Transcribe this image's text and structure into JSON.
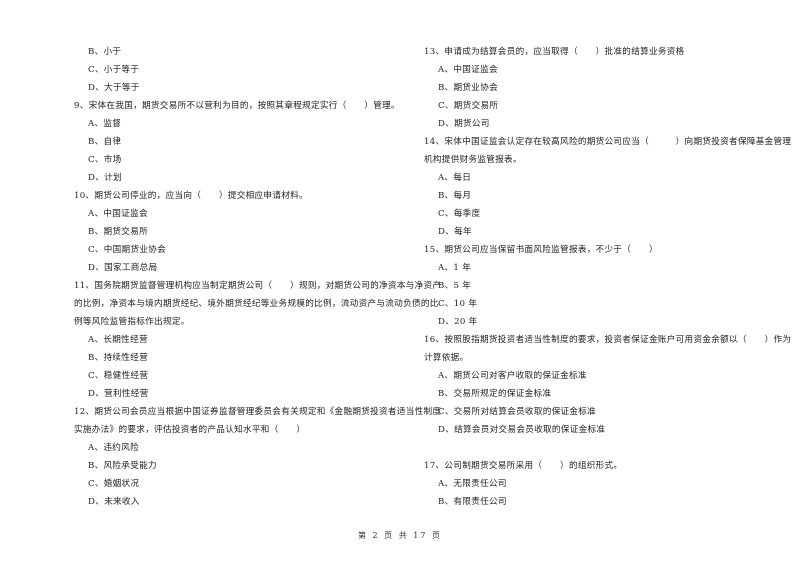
{
  "left_column": [
    {
      "type": "opt",
      "text": "B、小于"
    },
    {
      "type": "opt",
      "text": "C、小于等于"
    },
    {
      "type": "opt",
      "text": "D、大于等于"
    },
    {
      "type": "q",
      "text": "9、宋体在我国，期货交易所不以营利为目的，按照其章程规定实行（　　）管理。"
    },
    {
      "type": "opt",
      "text": "A、监督"
    },
    {
      "type": "opt",
      "text": "B、自律"
    },
    {
      "type": "opt",
      "text": "C、市场"
    },
    {
      "type": "opt",
      "text": "D、计划"
    },
    {
      "type": "q",
      "text": "10、期货公司停业的，应当向（　　）提交相应申请材料。"
    },
    {
      "type": "opt",
      "text": "A、中国证监会"
    },
    {
      "type": "opt",
      "text": "B、期货交易所"
    },
    {
      "type": "opt",
      "text": "C、中国期货业协会"
    },
    {
      "type": "opt",
      "text": "D、国家工商总局"
    },
    {
      "type": "q",
      "text": "11、国务院期货监督管理机构应当制定期货公司（　　）规则，对期货公司的净资本与净资产"
    },
    {
      "type": "q",
      "text": "的比例，净资本与境内期货经纪、境外期货经纪等业务规模的比例，流动资产与流动负债的比"
    },
    {
      "type": "q",
      "text": "例等风险监管指标作出规定。"
    },
    {
      "type": "opt",
      "text": "A、长期性经营"
    },
    {
      "type": "opt",
      "text": "B、持续性经营"
    },
    {
      "type": "opt",
      "text": "C、稳健性经营"
    },
    {
      "type": "opt",
      "text": "D、营利性经营"
    },
    {
      "type": "q",
      "text": "12、期货公司会员应当根据中国证券监督管理委员会有关规定和《金融期货投资者适当性制度"
    },
    {
      "type": "q",
      "text": "实施办法》的要求，评估投资者的产品认知水平和（　　）"
    },
    {
      "type": "opt",
      "text": "A、违约风险"
    },
    {
      "type": "opt",
      "text": "B、风险承受能力"
    },
    {
      "type": "opt",
      "text": "C、婚姻状况"
    },
    {
      "type": "opt",
      "text": "D、未来收入"
    }
  ],
  "right_column": [
    {
      "type": "q",
      "text": "13、申请成为结算会员的，应当取得（　　）批准的结算业务资格"
    },
    {
      "type": "opt",
      "text": "A、中国证监会"
    },
    {
      "type": "opt",
      "text": "B、期货业协会"
    },
    {
      "type": "opt",
      "text": "C、期货交易所"
    },
    {
      "type": "opt",
      "text": "D、期货公司"
    },
    {
      "type": "q",
      "text": "14、宋体中国证监会认定存在较高风险的期货公司应当（　　　）向期货投资者保障基金管理"
    },
    {
      "type": "q",
      "text": "机构提供财务监管报表。"
    },
    {
      "type": "opt",
      "text": "A、每日"
    },
    {
      "type": "opt",
      "text": "B、每月"
    },
    {
      "type": "opt",
      "text": "C、每季度"
    },
    {
      "type": "opt",
      "text": "D、每年"
    },
    {
      "type": "q",
      "text": "15、期货公司应当保留书面风险监管报表，不少于（　　）"
    },
    {
      "type": "opt",
      "text": "A、1 年"
    },
    {
      "type": "opt",
      "text": "B、5 年"
    },
    {
      "type": "opt",
      "text": "C、10 年"
    },
    {
      "type": "opt",
      "text": "D、20 年"
    },
    {
      "type": "q",
      "text": "16、按照股指期货投资者适当性制度的要求，投资者保证金账户可用资金余额以（　　）作为"
    },
    {
      "type": "q",
      "text": "计算依据。"
    },
    {
      "type": "opt",
      "text": "A、期货公司对客户收取的保证金标准"
    },
    {
      "type": "opt",
      "text": "B、交易所规定的保证金标准"
    },
    {
      "type": "opt",
      "text": "C、交易所对结算会员收取的保证金标准"
    },
    {
      "type": "opt",
      "text": "D、结算会员对交易会员收取的保证金标准"
    },
    {
      "type": "gap",
      "text": ""
    },
    {
      "type": "q",
      "text": "17、公司制期货交易所采用（　　）的组织形式。"
    },
    {
      "type": "opt",
      "text": "A、无限责任公司"
    },
    {
      "type": "opt",
      "text": "B、有限责任公司"
    }
  ],
  "footer": {
    "page_label": "第 2 页 共 17 页"
  }
}
